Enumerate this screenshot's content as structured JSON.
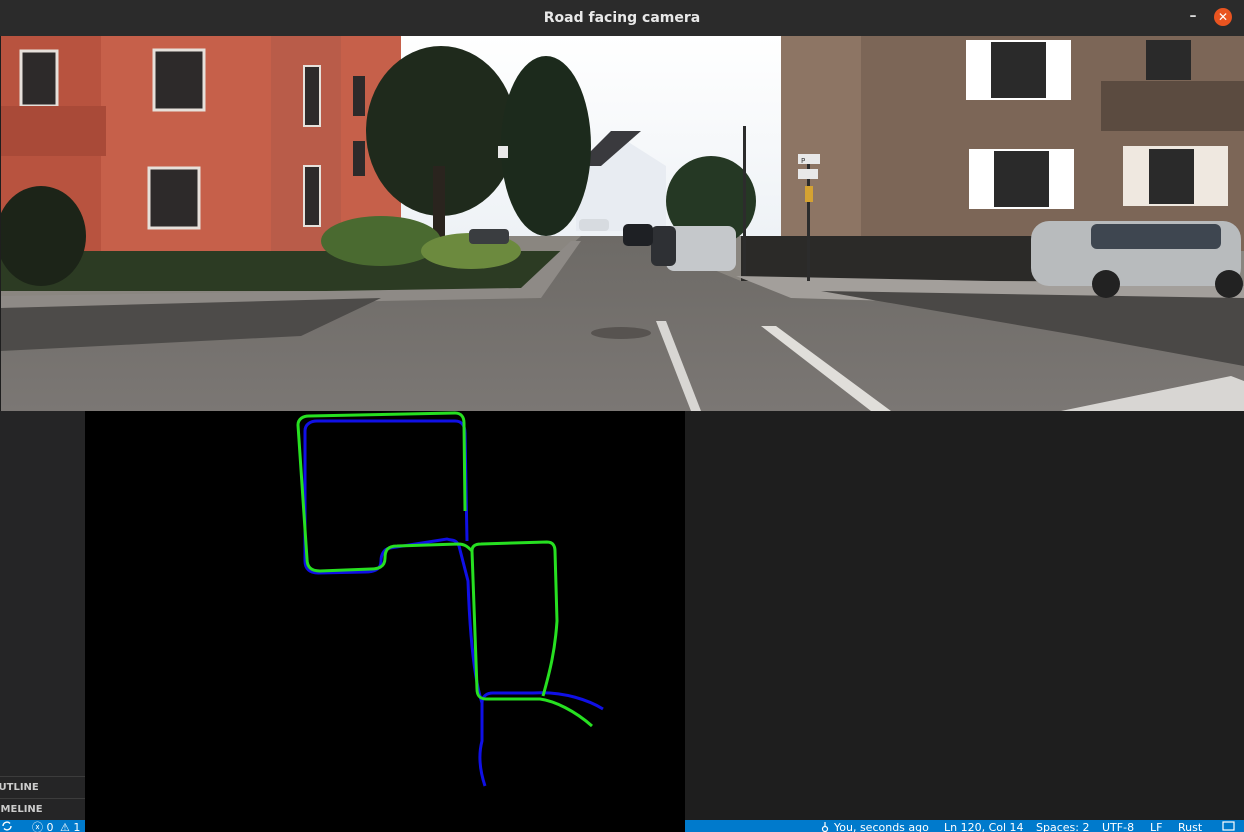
{
  "window": {
    "title": "Road facing camera",
    "minimize_glyph": "–",
    "close_glyph": "✕"
  },
  "camera_view": {
    "description_icon": "camera-frame",
    "sign_text": "P"
  },
  "trajectory_plot": {
    "ground_truth_color": "#27e021",
    "estimated_color": "#1010e6"
  },
  "sidebar": {
    "outline_label": "OUTLINE",
    "timeline_label": "TIMELINE"
  },
  "statusbar": {
    "sync_icon": "sync-icon",
    "errors": "ⓧ 0",
    "warnings": "⚠ 1",
    "git_blame": "You, seconds ago",
    "cursor": "Ln 120, Col 14",
    "spaces": "Spaces: 2",
    "encoding": "UTF-8",
    "eol": "LF",
    "language": "Rust",
    "feedback_icon": "feedback-icon"
  },
  "colors": {
    "statusbar": "#007acc",
    "close_button": "#e95420",
    "titlebar": "#2b2b2b"
  }
}
